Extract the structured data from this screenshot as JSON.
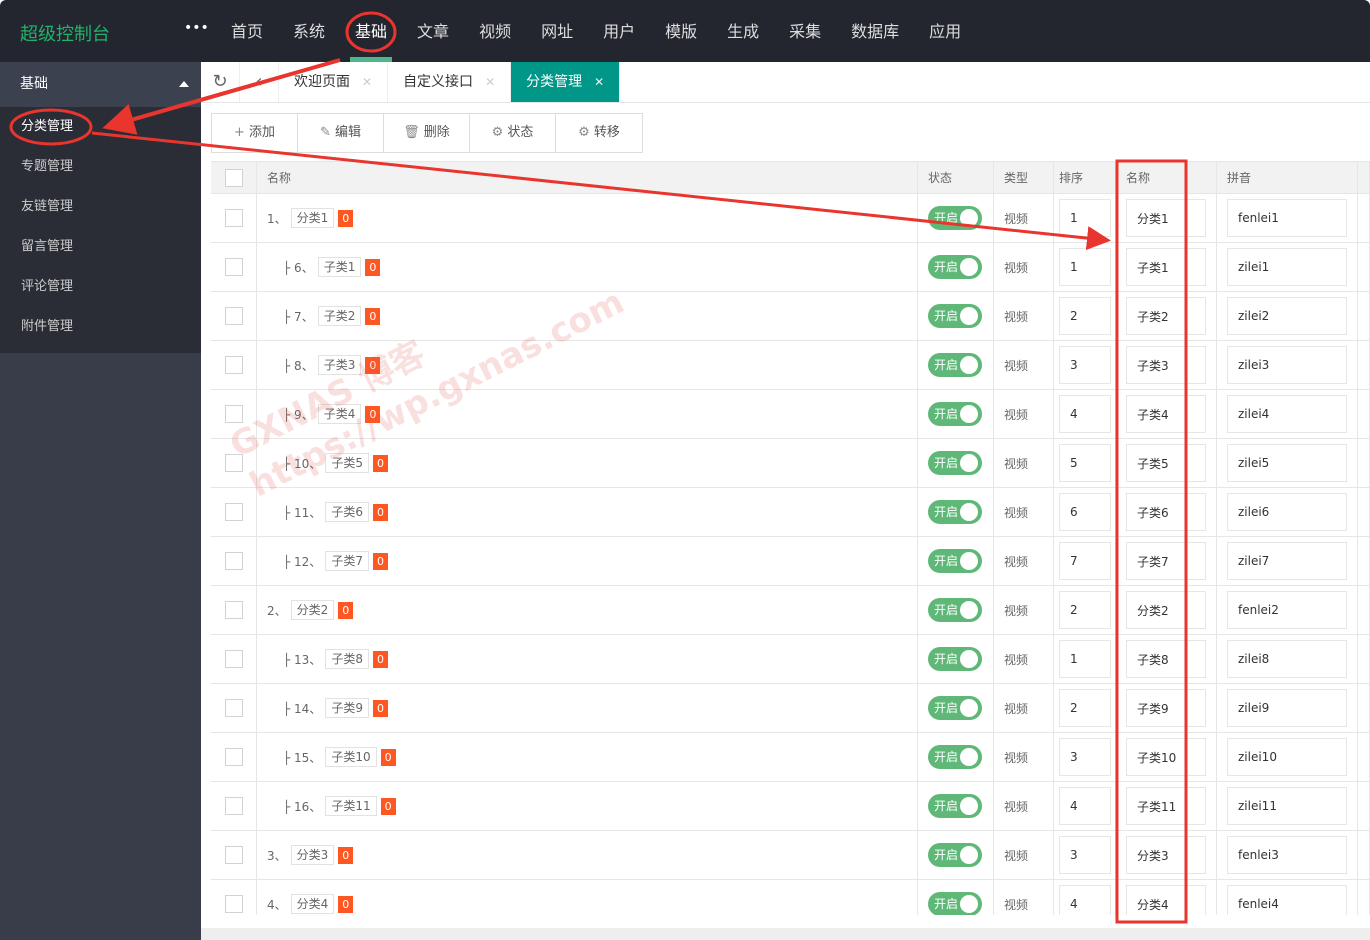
{
  "app": {
    "title": "超级控制台",
    "more": "•••"
  },
  "nav": [
    "首页",
    "系统",
    "基础",
    "文章",
    "视频",
    "网址",
    "用户",
    "模版",
    "生成",
    "采集",
    "数据库",
    "应用"
  ],
  "nav_active": 2,
  "sidebar": {
    "group": "基础",
    "items": [
      "分类管理",
      "专题管理",
      "友链管理",
      "留言管理",
      "评论管理",
      "附件管理"
    ],
    "selected": 0
  },
  "tabs": [
    {
      "label": "欢迎页面",
      "active": false
    },
    {
      "label": "自定义接口",
      "active": false
    },
    {
      "label": "分类管理",
      "active": true
    }
  ],
  "toolbar": [
    {
      "icon": "plus-icon",
      "glyph": "+",
      "label": "添加"
    },
    {
      "icon": "pencil-icon",
      "glyph": "✎",
      "label": "编辑"
    },
    {
      "icon": "trash-icon",
      "glyph": "🗑",
      "label": "删除"
    },
    {
      "icon": "gear-icon",
      "glyph": "⚙",
      "label": "状态"
    },
    {
      "icon": "gear-icon",
      "glyph": "⚙",
      "label": "转移"
    }
  ],
  "columns": [
    "名称",
    "状态",
    "类型",
    "排序",
    "名称",
    "拼音"
  ],
  "switch_label": "开启",
  "rows": [
    {
      "id": "1",
      "name": "分类1",
      "count": "0",
      "level": 0,
      "type": "视频",
      "sort": "1",
      "title": "分类1",
      "pinyin": "fenlei1"
    },
    {
      "id": "6",
      "name": "子类1",
      "count": "0",
      "level": 1,
      "type": "视频",
      "sort": "1",
      "title": "子类1",
      "pinyin": "zilei1"
    },
    {
      "id": "7",
      "name": "子类2",
      "count": "0",
      "level": 1,
      "type": "视频",
      "sort": "2",
      "title": "子类2",
      "pinyin": "zilei2"
    },
    {
      "id": "8",
      "name": "子类3",
      "count": "0",
      "level": 1,
      "type": "视频",
      "sort": "3",
      "title": "子类3",
      "pinyin": "zilei3"
    },
    {
      "id": "9",
      "name": "子类4",
      "count": "0",
      "level": 1,
      "type": "视频",
      "sort": "4",
      "title": "子类4",
      "pinyin": "zilei4"
    },
    {
      "id": "10",
      "name": "子类5",
      "count": "0",
      "level": 1,
      "type": "视频",
      "sort": "5",
      "title": "子类5",
      "pinyin": "zilei5"
    },
    {
      "id": "11",
      "name": "子类6",
      "count": "0",
      "level": 1,
      "type": "视频",
      "sort": "6",
      "title": "子类6",
      "pinyin": "zilei6"
    },
    {
      "id": "12",
      "name": "子类7",
      "count": "0",
      "level": 1,
      "type": "视频",
      "sort": "7",
      "title": "子类7",
      "pinyin": "zilei7"
    },
    {
      "id": "2",
      "name": "分类2",
      "count": "0",
      "level": 0,
      "type": "视频",
      "sort": "2",
      "title": "分类2",
      "pinyin": "fenlei2"
    },
    {
      "id": "13",
      "name": "子类8",
      "count": "0",
      "level": 1,
      "type": "视频",
      "sort": "1",
      "title": "子类8",
      "pinyin": "zilei8"
    },
    {
      "id": "14",
      "name": "子类9",
      "count": "0",
      "level": 1,
      "type": "视频",
      "sort": "2",
      "title": "子类9",
      "pinyin": "zilei9"
    },
    {
      "id": "15",
      "name": "子类10",
      "count": "0",
      "level": 1,
      "type": "视频",
      "sort": "3",
      "title": "子类10",
      "pinyin": "zilei10"
    },
    {
      "id": "16",
      "name": "子类11",
      "count": "0",
      "level": 1,
      "type": "视频",
      "sort": "4",
      "title": "子类11",
      "pinyin": "zilei11"
    },
    {
      "id": "3",
      "name": "分类3",
      "count": "0",
      "level": 0,
      "type": "视频",
      "sort": "3",
      "title": "分类3",
      "pinyin": "fenlei3"
    },
    {
      "id": "4",
      "name": "分类4",
      "count": "0",
      "level": 0,
      "type": "视频",
      "sort": "4",
      "title": "分类4",
      "pinyin": "fenlei4"
    }
  ],
  "watermark": [
    "GXNAS 博客",
    "https://wp.gxnas.com"
  ]
}
